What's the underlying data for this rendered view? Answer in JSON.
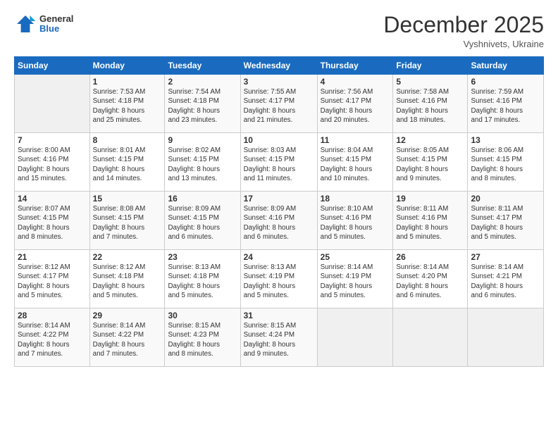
{
  "header": {
    "logo": {
      "general": "General",
      "blue": "Blue"
    },
    "title": "December 2025",
    "subtitle": "Vyshnivets, Ukraine"
  },
  "calendar": {
    "weekdays": [
      "Sunday",
      "Monday",
      "Tuesday",
      "Wednesday",
      "Thursday",
      "Friday",
      "Saturday"
    ],
    "weeks": [
      [
        {
          "day": "",
          "info": ""
        },
        {
          "day": "1",
          "info": "Sunrise: 7:53 AM\nSunset: 4:18 PM\nDaylight: 8 hours\nand 25 minutes."
        },
        {
          "day": "2",
          "info": "Sunrise: 7:54 AM\nSunset: 4:18 PM\nDaylight: 8 hours\nand 23 minutes."
        },
        {
          "day": "3",
          "info": "Sunrise: 7:55 AM\nSunset: 4:17 PM\nDaylight: 8 hours\nand 21 minutes."
        },
        {
          "day": "4",
          "info": "Sunrise: 7:56 AM\nSunset: 4:17 PM\nDaylight: 8 hours\nand 20 minutes."
        },
        {
          "day": "5",
          "info": "Sunrise: 7:58 AM\nSunset: 4:16 PM\nDaylight: 8 hours\nand 18 minutes."
        },
        {
          "day": "6",
          "info": "Sunrise: 7:59 AM\nSunset: 4:16 PM\nDaylight: 8 hours\nand 17 minutes."
        }
      ],
      [
        {
          "day": "7",
          "info": "Sunrise: 8:00 AM\nSunset: 4:16 PM\nDaylight: 8 hours\nand 15 minutes."
        },
        {
          "day": "8",
          "info": "Sunrise: 8:01 AM\nSunset: 4:15 PM\nDaylight: 8 hours\nand 14 minutes."
        },
        {
          "day": "9",
          "info": "Sunrise: 8:02 AM\nSunset: 4:15 PM\nDaylight: 8 hours\nand 13 minutes."
        },
        {
          "day": "10",
          "info": "Sunrise: 8:03 AM\nSunset: 4:15 PM\nDaylight: 8 hours\nand 11 minutes."
        },
        {
          "day": "11",
          "info": "Sunrise: 8:04 AM\nSunset: 4:15 PM\nDaylight: 8 hours\nand 10 minutes."
        },
        {
          "day": "12",
          "info": "Sunrise: 8:05 AM\nSunset: 4:15 PM\nDaylight: 8 hours\nand 9 minutes."
        },
        {
          "day": "13",
          "info": "Sunrise: 8:06 AM\nSunset: 4:15 PM\nDaylight: 8 hours\nand 8 minutes."
        }
      ],
      [
        {
          "day": "14",
          "info": "Sunrise: 8:07 AM\nSunset: 4:15 PM\nDaylight: 8 hours\nand 8 minutes."
        },
        {
          "day": "15",
          "info": "Sunrise: 8:08 AM\nSunset: 4:15 PM\nDaylight: 8 hours\nand 7 minutes."
        },
        {
          "day": "16",
          "info": "Sunrise: 8:09 AM\nSunset: 4:15 PM\nDaylight: 8 hours\nand 6 minutes."
        },
        {
          "day": "17",
          "info": "Sunrise: 8:09 AM\nSunset: 4:16 PM\nDaylight: 8 hours\nand 6 minutes."
        },
        {
          "day": "18",
          "info": "Sunrise: 8:10 AM\nSunset: 4:16 PM\nDaylight: 8 hours\nand 5 minutes."
        },
        {
          "day": "19",
          "info": "Sunrise: 8:11 AM\nSunset: 4:16 PM\nDaylight: 8 hours\nand 5 minutes."
        },
        {
          "day": "20",
          "info": "Sunrise: 8:11 AM\nSunset: 4:17 PM\nDaylight: 8 hours\nand 5 minutes."
        }
      ],
      [
        {
          "day": "21",
          "info": "Sunrise: 8:12 AM\nSunset: 4:17 PM\nDaylight: 8 hours\nand 5 minutes."
        },
        {
          "day": "22",
          "info": "Sunrise: 8:12 AM\nSunset: 4:18 PM\nDaylight: 8 hours\nand 5 minutes."
        },
        {
          "day": "23",
          "info": "Sunrise: 8:13 AM\nSunset: 4:18 PM\nDaylight: 8 hours\nand 5 minutes."
        },
        {
          "day": "24",
          "info": "Sunrise: 8:13 AM\nSunset: 4:19 PM\nDaylight: 8 hours\nand 5 minutes."
        },
        {
          "day": "25",
          "info": "Sunrise: 8:14 AM\nSunset: 4:19 PM\nDaylight: 8 hours\nand 5 minutes."
        },
        {
          "day": "26",
          "info": "Sunrise: 8:14 AM\nSunset: 4:20 PM\nDaylight: 8 hours\nand 6 minutes."
        },
        {
          "day": "27",
          "info": "Sunrise: 8:14 AM\nSunset: 4:21 PM\nDaylight: 8 hours\nand 6 minutes."
        }
      ],
      [
        {
          "day": "28",
          "info": "Sunrise: 8:14 AM\nSunset: 4:22 PM\nDaylight: 8 hours\nand 7 minutes."
        },
        {
          "day": "29",
          "info": "Sunrise: 8:14 AM\nSunset: 4:22 PM\nDaylight: 8 hours\nand 7 minutes."
        },
        {
          "day": "30",
          "info": "Sunrise: 8:15 AM\nSunset: 4:23 PM\nDaylight: 8 hours\nand 8 minutes."
        },
        {
          "day": "31",
          "info": "Sunrise: 8:15 AM\nSunset: 4:24 PM\nDaylight: 8 hours\nand 9 minutes."
        },
        {
          "day": "",
          "info": ""
        },
        {
          "day": "",
          "info": ""
        },
        {
          "day": "",
          "info": ""
        }
      ]
    ]
  }
}
